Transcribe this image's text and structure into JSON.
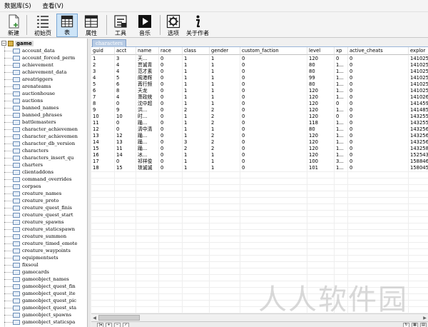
{
  "menu": [
    {
      "id": "database",
      "label": "数据库(S)"
    },
    {
      "id": "view",
      "label": "查看(V)"
    }
  ],
  "toolbar": {
    "new": "新建",
    "initpage": "初始页",
    "table": "表",
    "properties": "属性",
    "tools": "工具",
    "music": "音乐",
    "options": "选项",
    "about": "关于作者"
  },
  "tree": {
    "root": "game",
    "items": [
      "account_data",
      "account_forced_perm",
      "achievement",
      "achievement_data",
      "areatriggers",
      "arenateams",
      "auctionhouse",
      "auctions",
      "banned_names",
      "banned_phrases",
      "battlemasters",
      "character_achievemen",
      "character_achievemen",
      "character_db_version",
      "characters",
      "characters_insert_qu",
      "charters",
      "clientaddons",
      "command_overrides",
      "corpses",
      "creature_names",
      "creature_proto",
      "creature_quest_finis",
      "creature_quest_start",
      "creature_spawns",
      "creature_staticspawn",
      "creature_summon",
      "creature_timed_emote",
      "creature_waypoints",
      "equipmentsets",
      "fixsoul",
      "gamecards",
      "gameobject_names",
      "gameobject_quest_fin",
      "gameobject_quest_ite",
      "gameobject_quest_pic",
      "gameobject_quest_sta",
      "gameobject_spawns",
      "gameobject_staticspa"
    ]
  },
  "tab": {
    "label": "characters"
  },
  "grid": {
    "columns": [
      "guid",
      "acct",
      "name",
      "race",
      "class",
      "gender",
      "custom_faction",
      "level",
      "xp",
      "active_cheats",
      "explor"
    ],
    "rows": [
      [
        "1",
        "3",
        "天...",
        "0",
        "1",
        "1",
        "0",
        "120",
        "0",
        "0",
        "141025"
      ],
      [
        "2",
        "4",
        "贾诚青",
        "0",
        "1",
        "1",
        "0",
        "80",
        "1...",
        "0",
        "141025"
      ],
      [
        "3",
        "4",
        "范才素",
        "0",
        "1",
        "1",
        "0",
        "80",
        "1...",
        "0",
        "141025"
      ],
      [
        "4",
        "5",
        "阁港辉",
        "0",
        "1",
        "1",
        "0",
        "99",
        "1...",
        "0",
        "141025"
      ],
      [
        "5",
        "6",
        "苒行频",
        "0",
        "1",
        "1",
        "0",
        "80",
        "1...",
        "0",
        "141025"
      ],
      [
        "6",
        "8",
        "天龙",
        "0",
        "1",
        "1",
        "0",
        "120",
        "1...",
        "0",
        "141025"
      ],
      [
        "7",
        "4",
        "萧政统",
        "0",
        "1",
        "1",
        "0",
        "120",
        "1...",
        "0",
        "141026"
      ],
      [
        "8",
        "0",
        "沈中超",
        "0",
        "1",
        "1",
        "0",
        "120",
        "0",
        "0",
        "141459"
      ],
      [
        "9",
        "9",
        "洪...",
        "0",
        "2",
        "2",
        "0",
        "120",
        "1...",
        "0",
        "141485"
      ],
      [
        "10",
        "10",
        "时...",
        "0",
        "1",
        "2",
        "0",
        "120",
        "0",
        "0",
        "143255"
      ],
      [
        "11",
        "0",
        "踊...",
        "0",
        "1",
        "2",
        "0",
        "118",
        "1...",
        "0",
        "143255"
      ],
      [
        "12",
        "0",
        "清中清",
        "0",
        "1",
        "1",
        "0",
        "80",
        "1...",
        "0",
        "143256"
      ],
      [
        "13",
        "12",
        "踊...",
        "0",
        "1",
        "2",
        "0",
        "120",
        "1...",
        "0",
        "143256"
      ],
      [
        "14",
        "13",
        "踊...",
        "0",
        "3",
        "2",
        "0",
        "120",
        "1...",
        "0",
        "143256"
      ],
      [
        "15",
        "11",
        "踊...",
        "0",
        "2",
        "2",
        "0",
        "120",
        "1...",
        "0",
        "143258"
      ],
      [
        "16",
        "14",
        "冰...",
        "0",
        "1",
        "1",
        "0",
        "120",
        "1...",
        "0",
        "152543"
      ],
      [
        "17",
        "0",
        "祁祥俊",
        "0",
        "1",
        "1",
        "0",
        "100",
        "3...",
        "0",
        "158846"
      ],
      [
        "18",
        "15",
        "琐诚诚",
        "0",
        "1",
        "1",
        "0",
        "101",
        "1...",
        "0",
        "158045"
      ]
    ]
  },
  "watermark": "人人软件园",
  "colors": {
    "selected_button": "#cde4f7",
    "tab_fill": "#b7cbe4",
    "grid_line": "#eeeeee"
  }
}
